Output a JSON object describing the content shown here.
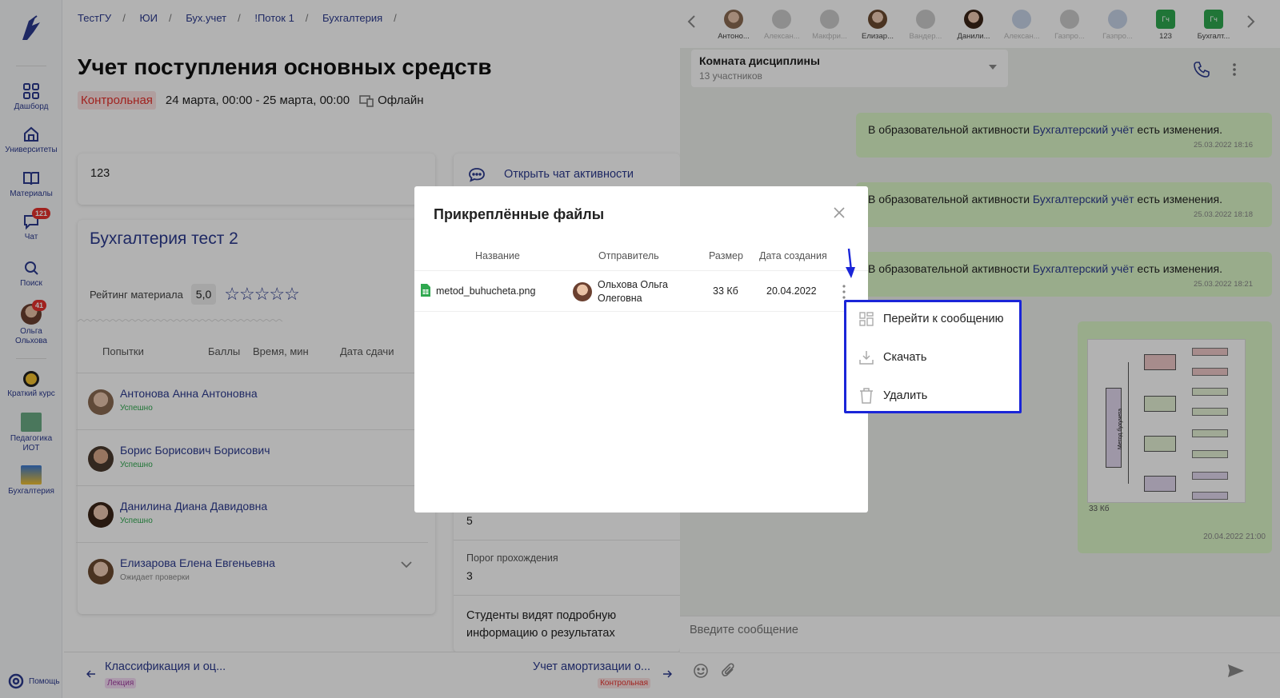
{
  "breadcrumbs": [
    "ТестГУ",
    "ЮИ",
    "Бух.учет",
    "!Поток 1",
    "Бухгалтерия"
  ],
  "page_title": "Учет поступления основных средств",
  "meta": {
    "type_badge": "Контрольная",
    "dates": "24 марта, 00:00 - 25 марта, 00:00",
    "format": "Офлайн"
  },
  "sidebar": {
    "items": [
      {
        "label": "Дашборд",
        "icon": "grid-icon"
      },
      {
        "label": "Университеты",
        "icon": "home-icon"
      },
      {
        "label": "Материалы",
        "icon": "book-icon"
      },
      {
        "label": "Чат",
        "icon": "chat-icon",
        "badge": "121"
      },
      {
        "label": "Поиск",
        "icon": "search-icon"
      },
      {
        "label": "Ольга Ольхова",
        "icon": "avatar",
        "badge": "41"
      }
    ],
    "courses": [
      {
        "label": "Краткий курс"
      },
      {
        "label": "Педагогика ИОТ"
      },
      {
        "label": "Бухгалтерия"
      }
    ],
    "help": "Помощь"
  },
  "description_card": {
    "text": "123"
  },
  "chat_link": "Открыть чат активности",
  "material": {
    "title": "Бухгалтерия тест 2",
    "rating_label": "Рейтинг материала",
    "rating_value": "5,0",
    "stars": 0
  },
  "attempts": {
    "headers": [
      "Попытки",
      "Баллы",
      "Время, мин",
      "Дата сдачи"
    ],
    "rows": [
      {
        "name": "Антонова Анна Антоновна",
        "status": "Успешно"
      },
      {
        "name": "Борис Борисович Борисович",
        "status": "Успешно"
      },
      {
        "name": "Данилина Диана Давидовна",
        "status": "Успешно"
      },
      {
        "name": "Елизарова Елена Евгеньевна",
        "status": "Ожидает проверки"
      }
    ]
  },
  "settings": {
    "value1": "5",
    "threshold_label": "Порог прохождения",
    "threshold_value": "3",
    "note": "Студенты видят подробную информацию о результатах"
  },
  "bottom_nav": {
    "prev": {
      "title": "Классификация и оц...",
      "tag": "Лекция"
    },
    "next": {
      "title": "Учет амортизации о...",
      "tag": "Контрольная"
    }
  },
  "chat": {
    "participants": [
      {
        "label": "Антоно..."
      },
      {
        "label": "Алексан..."
      },
      {
        "label": "Макфри..."
      },
      {
        "label": "Елизар..."
      },
      {
        "label": "Вандер..."
      },
      {
        "label": "Данили..."
      },
      {
        "label": "Алексан..."
      },
      {
        "label": "Газпро..."
      },
      {
        "label": "Газпро..."
      },
      {
        "label": "123",
        "box": "Гч"
      },
      {
        "label": "Бухгалт...",
        "box": "Гч"
      }
    ],
    "room_title": "Комната дисциплины",
    "room_members": "13 участников",
    "messages": [
      {
        "pre": "В образовательной активности ",
        "link": "Бухгалтерский учёт",
        "post": " есть изменения.",
        "time": "25.03.2022 18:16"
      },
      {
        "pre": "В образовательной активности ",
        "link": "Бухгалтерский учёт",
        "post": " есть изменения.",
        "time": "25.03.2022 18:18"
      },
      {
        "pre": "В образовательной активности ",
        "link": "Бухгалтерский учёт",
        "post": " есть изменения.",
        "time": "25.03.2022 18:21"
      }
    ],
    "image_message": {
      "size": "33 Кб",
      "time": "20.04.2022 21:00",
      "diagram_label": "Метод бухучета"
    },
    "input_placeholder": "Введите сообщение"
  },
  "modal": {
    "title": "Прикреплённые файлы",
    "columns": [
      "Название",
      "Отправитель",
      "Размер",
      "Дата создания"
    ],
    "file": {
      "name": "metod_buhucheta.png",
      "sender": "Ольхова Ольга Олеговна",
      "size": "33 Кб",
      "date": "20.04.2022"
    }
  },
  "context_menu": {
    "items": [
      "Перейти к сообщению",
      "Скачать",
      "Удалить"
    ]
  },
  "colors": {
    "accent": "#2b3a8f",
    "highlight": "#1a25d8",
    "badge_red": "#e5322d",
    "success": "#2fa84f",
    "bubble": "#dcf7c8"
  }
}
